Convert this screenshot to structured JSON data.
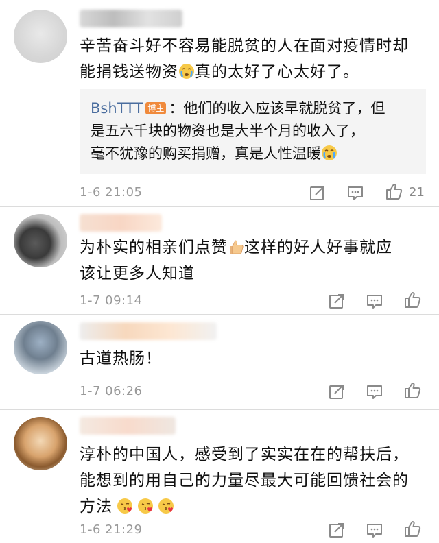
{
  "comments": [
    {
      "text_line1": "辛苦奋斗好不容易能脱贫的人在面对疫情时却",
      "text_line2_pre": "能捐钱送物资",
      "text_line2_post": "真的太好了心太好了。",
      "reply": {
        "author": "BshTTT",
        "badge": "博主",
        "line1": "：他们的收入应该早就脱贫了，但",
        "line2": "是五六千块的物资也是大半个月的收入了，",
        "line3": "毫不犹豫的购买捐赠，真是人性温暖"
      },
      "time": "1-6 21:05",
      "likes": "21"
    },
    {
      "text_line1_pre": "为朴实的相亲们点赞",
      "text_line1_post": "这样的好人好事就应",
      "text_line2": "该让更多人知道",
      "time": "1-7 09:14"
    },
    {
      "text_line1": "古道热肠！",
      "time": "1-7 06:26"
    },
    {
      "text_line1": "淳朴的中国人，感受到了实实在在的帮扶后，",
      "text_line2": "能想到的用自己的力量尽最大可能回馈社会的",
      "text_line3": "方法",
      "time": "1-6 21:29"
    }
  ],
  "icons": {
    "share": "share-icon",
    "comment": "comment-icon",
    "like": "thumbs-up-icon",
    "cry_emoji": "crying-face-emoji",
    "thumb_emoji": "thumbs-up-emoji",
    "kiss_emoji": "face-blowing-kiss-emoji"
  },
  "colors": {
    "link": "#4a6d9e",
    "badge": "#f08a3c",
    "meta": "#999999",
    "divider": "#dcdcdc",
    "reply_bg": "#f4f4f4"
  }
}
